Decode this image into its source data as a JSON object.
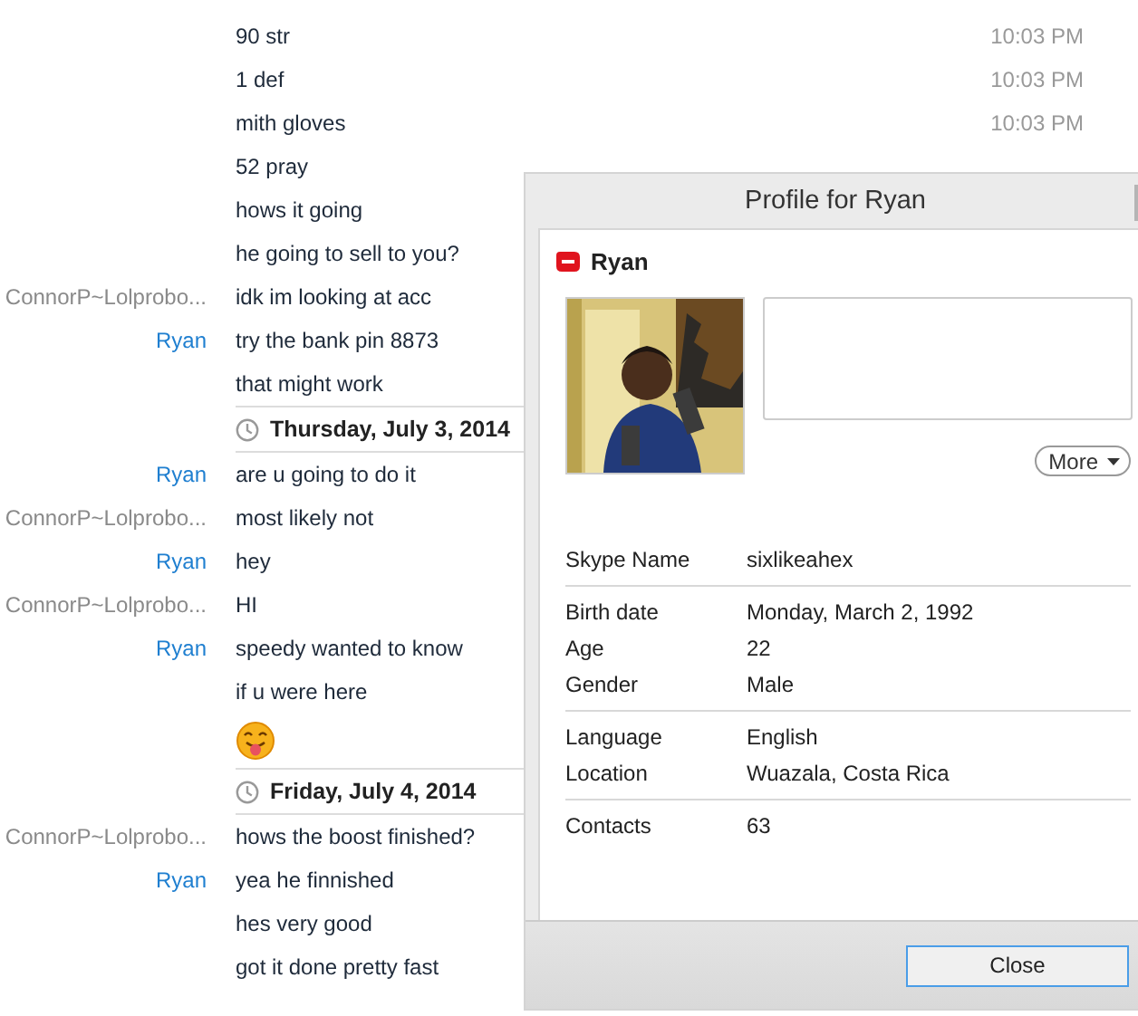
{
  "chat": [
    {
      "kind": "message",
      "text": "90 str",
      "time": "10:03 PM"
    },
    {
      "kind": "message",
      "text": "1 def",
      "time": "10:03 PM"
    },
    {
      "kind": "message",
      "text": "mith gloves",
      "time": "10:03 PM"
    },
    {
      "kind": "message",
      "text": "52 pray"
    },
    {
      "kind": "message",
      "text": "hows it going"
    },
    {
      "kind": "message",
      "text": "he going to sell to you?"
    },
    {
      "kind": "message",
      "sender": "ConnorP~Lolprobo...",
      "color": "#8a8a8a",
      "text": "idk im looking at acc"
    },
    {
      "kind": "message",
      "sender": "Ryan",
      "color": "#1f7fd0",
      "text": "try the bank pin 8873"
    },
    {
      "kind": "message",
      "text": "that might work"
    },
    {
      "kind": "date",
      "text": "Thursday, July 3, 2014"
    },
    {
      "kind": "message",
      "sender": "Ryan",
      "color": "#1f7fd0",
      "text": "are u going to do it"
    },
    {
      "kind": "message",
      "sender": "ConnorP~Lolprobo...",
      "color": "#8a8a8a",
      "text": "most likely not"
    },
    {
      "kind": "message",
      "sender": "Ryan",
      "color": "#1f7fd0",
      "text": "hey"
    },
    {
      "kind": "message",
      "sender": "ConnorP~Lolprobo...",
      "color": "#8a8a8a",
      "text": "HI"
    },
    {
      "kind": "message",
      "sender": "Ryan",
      "color": "#1f7fd0",
      "text": "speedy wanted to know"
    },
    {
      "kind": "message",
      "text": "if u were here"
    },
    {
      "kind": "emoji"
    },
    {
      "kind": "date",
      "text": "Friday, July 4, 2014"
    },
    {
      "kind": "message",
      "sender": "ConnorP~Lolprobo...",
      "color": "#8a8a8a",
      "text": "hows the boost finished?"
    },
    {
      "kind": "message",
      "sender": "Ryan",
      "color": "#1f7fd0",
      "text": "yea he finnished"
    },
    {
      "kind": "message",
      "text": "hes very good"
    },
    {
      "kind": "message",
      "text": "got it done pretty fast"
    }
  ],
  "profile": {
    "title": "Profile for Ryan",
    "name": "Ryan",
    "do_not_disturb": true,
    "more_button": "More",
    "groups": [
      {
        "rows": [
          {
            "label": "Skype Name",
            "value": "sixlikeahex"
          }
        ]
      },
      {
        "rows": [
          {
            "label": "Birth date",
            "value": "Monday, March 2, 1992"
          },
          {
            "label": "Age",
            "value": "22"
          },
          {
            "label": "Gender",
            "value": "Male"
          }
        ]
      },
      {
        "rows": [
          {
            "label": "Language",
            "value": "English"
          },
          {
            "label": "Location",
            "value": "Wuazala, Costa Rica"
          }
        ]
      },
      {
        "rows": [
          {
            "label": "Contacts",
            "value": "63"
          }
        ]
      }
    ],
    "close_button": "Close"
  }
}
